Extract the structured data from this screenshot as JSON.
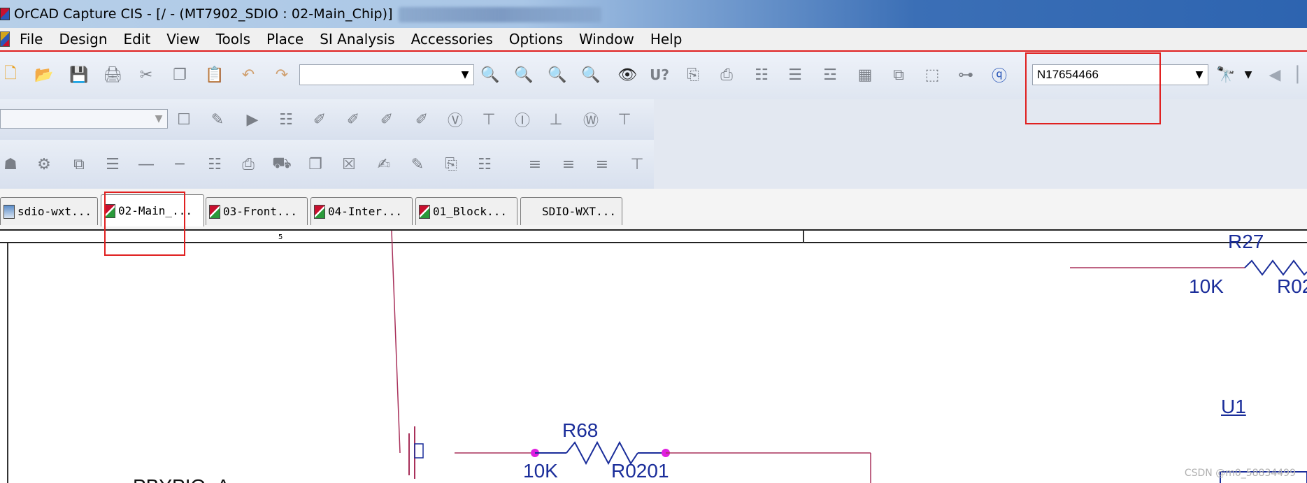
{
  "window": {
    "title": "OrCAD Capture CIS - [/ - (MT7902_SDIO : 02-Main_Chip)]"
  },
  "menu": [
    "File",
    "Design",
    "Edit",
    "View",
    "Tools",
    "Place",
    "SI Analysis",
    "Accessories",
    "Options",
    "Window",
    "Help"
  ],
  "toolbar": {
    "part_combo_value": "",
    "search_value": "N17654466",
    "toolbar2_combo_value": "",
    "icons": [
      "new-file-icon",
      "open-folder-icon",
      "save-icon",
      "print-icon",
      "cut-icon",
      "copy-icon",
      "paste-icon",
      "undo-icon",
      "redo-icon",
      "zoom-in-icon",
      "zoom-out-icon",
      "zoom-area-icon",
      "zoom-all-icon",
      "eye-icon",
      "annotate-icon",
      "binoculars-icon"
    ]
  },
  "tabs": [
    {
      "label": "sdio-wxt..."
    },
    {
      "label": "02-Main_..."
    },
    {
      "label": "03-Front..."
    },
    {
      "label": "04-Inter..."
    },
    {
      "label": "01_Block..."
    },
    {
      "label": "SDIO-WXT..."
    }
  ],
  "schematic": {
    "ruler_number": "5",
    "r27_ref": "R27",
    "r27_value": "10K",
    "r27_package": "R02",
    "u1_ref": "U1",
    "r68_ref": "R68",
    "r68_value": "10K",
    "r68_package": "R0201",
    "net_label_partial": "PBYPIO_A"
  },
  "watermark": "CSDN @m0_58834499",
  "colors": {
    "highlight_red": "#e02020",
    "wire": "#a8305a",
    "component_blue": "#1a2d9a",
    "junction": "#e020e0"
  }
}
